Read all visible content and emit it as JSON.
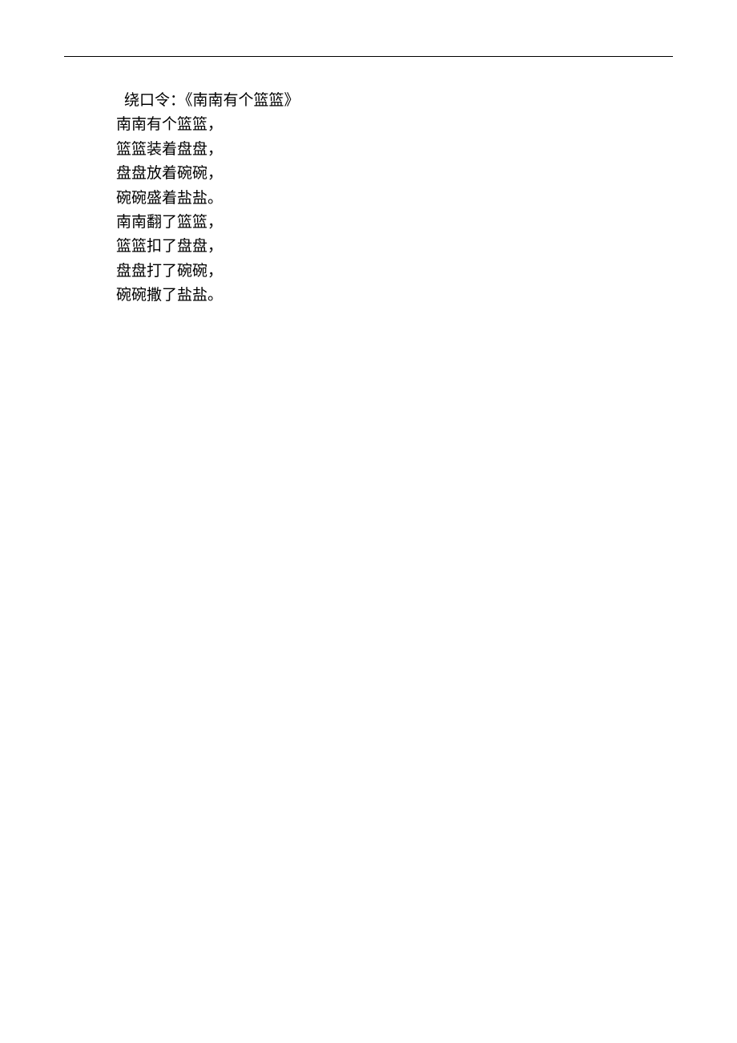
{
  "document": {
    "titlePrefix": "绕口令：",
    "title": "《南南有个篮篮》",
    "lines": [
      "南南有个篮篮，",
      "篮篮装着盘盘，",
      "盘盘放着碗碗，",
      "碗碗盛着盐盐。",
      "南南翻了篮篮，",
      "篮篮扣了盘盘，",
      "盘盘打了碗碗，",
      "碗碗撒了盐盐。"
    ]
  }
}
